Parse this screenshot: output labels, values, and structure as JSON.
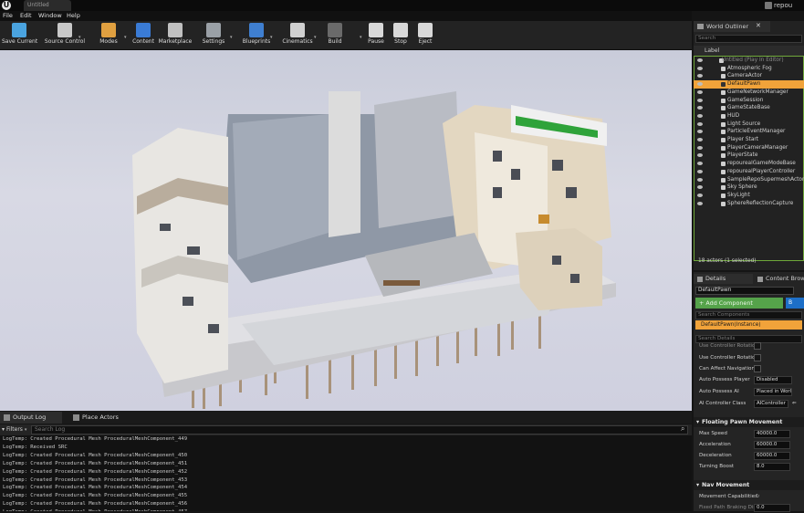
{
  "window": {
    "title_tab": "Untitled",
    "user": "repou"
  },
  "menu": [
    "File",
    "Edit",
    "Window",
    "Help"
  ],
  "toolbar": [
    {
      "id": "save-current",
      "label": "Save Current",
      "icon": "save-icon",
      "color": "#4aa3df"
    },
    {
      "id": "source-control",
      "label": "Source Control",
      "icon": "source-control-icon",
      "color": "#c8c8c8"
    },
    {
      "id": "modes",
      "label": "Modes",
      "icon": "modes-icon",
      "color": "#e0a040"
    },
    {
      "id": "content",
      "label": "Content",
      "icon": "content-icon",
      "color": "#3a7bd5"
    },
    {
      "id": "marketplace",
      "label": "Marketplace",
      "icon": "marketplace-icon",
      "color": "#c0c0c0"
    },
    {
      "id": "settings",
      "label": "Settings",
      "icon": "settings-icon",
      "color": "#9aa0a6"
    },
    {
      "id": "blueprints",
      "label": "Blueprints",
      "icon": "blueprints-icon",
      "color": "#3f7fd0"
    },
    {
      "id": "cinematics",
      "label": "Cinematics",
      "icon": "cinematics-icon",
      "color": "#d0d0d0"
    },
    {
      "id": "build",
      "label": "Build",
      "icon": "build-icon",
      "color": "#6a6a6a"
    },
    {
      "id": "pause",
      "label": "Pause",
      "icon": "pause-icon",
      "color": "#d8d8d8"
    },
    {
      "id": "stop",
      "label": "Stop",
      "icon": "stop-icon",
      "color": "#d8d8d8"
    },
    {
      "id": "eject",
      "label": "Eject",
      "icon": "eject-icon",
      "color": "#d8d8d8"
    }
  ],
  "log": {
    "tabs": [
      "Output Log",
      "Place Actors"
    ],
    "filters_label": "Filters",
    "search_placeholder": "Search Log",
    "lines": [
      "LogTemp: Created Procedural Mesh ProceduralMeshComponent_449",
      "LogTemp: Received SRC",
      "LogTemp: Created Procedural Mesh ProceduralMeshComponent_450",
      "LogTemp: Created Procedural Mesh ProceduralMeshComponent_451",
      "LogTemp: Created Procedural Mesh ProceduralMeshComponent_452",
      "LogTemp: Created Procedural Mesh ProceduralMeshComponent_453",
      "LogTemp: Created Procedural Mesh ProceduralMeshComponent_454",
      "LogTemp: Created Procedural Mesh ProceduralMeshComponent_455",
      "LogTemp: Created Procedural Mesh ProceduralMeshComponent_456",
      "LogTemp: Created Procedural Mesh ProceduralMeshComponent_457",
      "LogTemp: Created Procedural Mesh ProceduralMeshComponent_458"
    ]
  },
  "outliner": {
    "tab": "World Outliner",
    "search_placeholder": "Search",
    "column": "Label",
    "items": [
      {
        "label": "Untitled (Play In Editor)",
        "dim": true,
        "selected": false
      },
      {
        "label": "Atmospheric Fog",
        "dim": false,
        "selected": false
      },
      {
        "label": "CameraActor",
        "dim": false,
        "selected": false
      },
      {
        "label": "DefaultPawn",
        "dim": false,
        "selected": true
      },
      {
        "label": "GameNetworkManager",
        "dim": false,
        "selected": false
      },
      {
        "label": "GameSession",
        "dim": false,
        "selected": false
      },
      {
        "label": "GameStateBase",
        "dim": false,
        "selected": false
      },
      {
        "label": "HUD",
        "dim": false,
        "selected": false
      },
      {
        "label": "Light Source",
        "dim": false,
        "selected": false
      },
      {
        "label": "ParticleEventManager",
        "dim": false,
        "selected": false
      },
      {
        "label": "Player Start",
        "dim": false,
        "selected": false
      },
      {
        "label": "PlayerCameraManager",
        "dim": false,
        "selected": false
      },
      {
        "label": "PlayerState",
        "dim": false,
        "selected": false
      },
      {
        "label": "repourealGameModeBase",
        "dim": false,
        "selected": false
      },
      {
        "label": "repourealPlayerController",
        "dim": false,
        "selected": false
      },
      {
        "label": "SampleRepoSupermeshActor",
        "dim": false,
        "selected": false
      },
      {
        "label": "Sky Sphere",
        "dim": false,
        "selected": false
      },
      {
        "label": "SkyLight",
        "dim": false,
        "selected": false
      },
      {
        "label": "SphereReflectionCapture",
        "dim": false,
        "selected": false
      }
    ],
    "footer": "18 actors (1 selected)"
  },
  "details": {
    "tabs": [
      "Details",
      "Content Brow"
    ],
    "name_value": "DefaultPawn",
    "add_component": "+ Add Component",
    "search_components_placeholder": "Search Components",
    "instance": "DefaultPawn(Instance)",
    "search_details_placeholder": "Search Details",
    "rows": [
      {
        "label": "Use Controller Rotation",
        "type": "check"
      },
      {
        "label": "Use Controller Rotation",
        "type": "check"
      },
      {
        "label": "Can Affect Navigation",
        "type": "check"
      },
      {
        "label": "Auto Possess Player",
        "type": "select",
        "value": "Disabled"
      },
      {
        "label": "Auto Possess AI",
        "type": "select",
        "value": "Placed in World"
      },
      {
        "label": "AI Controller Class",
        "type": "select",
        "value": "AIController"
      }
    ],
    "section1": "Floating Pawn Movement",
    "movement_rows": [
      {
        "label": "Max Speed",
        "value": "40000.0"
      },
      {
        "label": "Acceleration",
        "value": "60000.0"
      },
      {
        "label": "Deceleration",
        "value": "60000.0"
      },
      {
        "label": "Turning Boost",
        "value": "8.0"
      }
    ],
    "section2": "Nav Movement",
    "movement_capabilities": "Movement Capabilities",
    "fixed_path_label": "Fixed Path Braking Dis",
    "fixed_path_value": "0.0"
  },
  "colors": {
    "accent_orange": "#f1a33a",
    "selection_blue": "#1d6fc8",
    "add_component_green": "#55a34a"
  }
}
